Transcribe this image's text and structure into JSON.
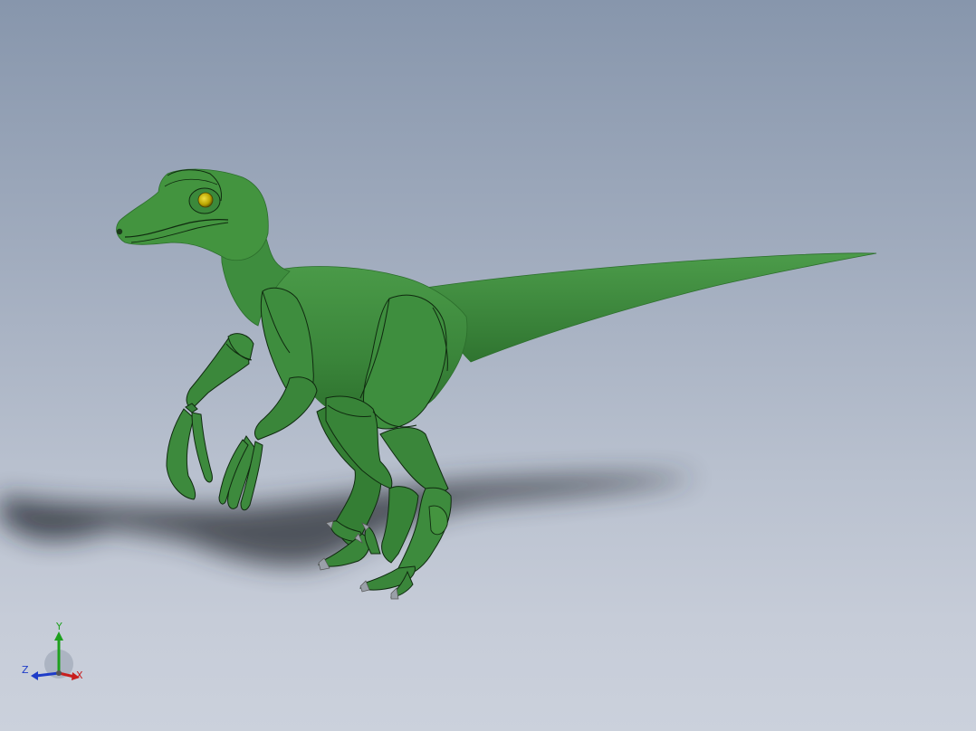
{
  "viewport": {
    "background_top": "#8796ac",
    "background_bottom": "#cbd1dc"
  },
  "model": {
    "body_color": "#3d8a3d",
    "body_dark": "#2c6e2c",
    "edge_color": "#0f2a0f",
    "eye_color": "#c7b400",
    "claw_color": "#9aa0a8",
    "shadow_color": "#2a2e36"
  },
  "triad": {
    "x_label": "X",
    "y_label": "Y",
    "z_label": "Z",
    "x_color": "#c81e1e",
    "y_color": "#1ea01e",
    "z_color": "#1e3cc8"
  }
}
